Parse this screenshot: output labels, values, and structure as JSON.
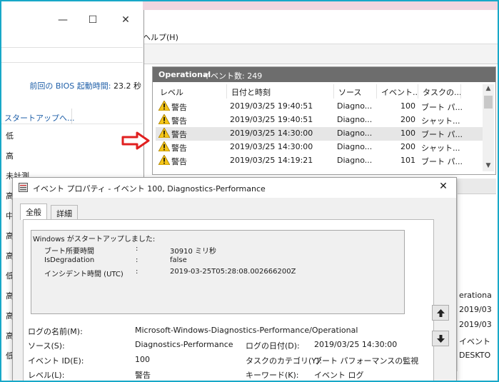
{
  "event_viewer": {
    "menu_help": "ヘルプ(H)",
    "operational": {
      "title": "Operational",
      "count_label": "イベント数: 249"
    },
    "columns": [
      "レベル",
      "日付と時刻",
      "ソース",
      "イベント...",
      "タスクの..."
    ],
    "rows": [
      {
        "level": "警告",
        "datetime": "2019/03/25 19:40:51",
        "source": "Diagno...",
        "id": "100",
        "task": "ブート パ..."
      },
      {
        "level": "警告",
        "datetime": "2019/03/25 19:40:51",
        "source": "Diagno...",
        "id": "200",
        "task": "シャット..."
      },
      {
        "level": "警告",
        "datetime": "2019/03/25 14:30:00",
        "source": "Diagno...",
        "id": "100",
        "task": "ブート パ..."
      },
      {
        "level": "警告",
        "datetime": "2019/03/25 14:30:00",
        "source": "Diagno...",
        "id": "200",
        "task": "シャット..."
      },
      {
        "level": "警告",
        "datetime": "2019/03/25 14:19:21",
        "source": "Diagno...",
        "id": "101",
        "task": "ブート パ..."
      }
    ],
    "right_fragments": [
      "erationa",
      "2019/03",
      "2019/03",
      "イベント",
      "DESKTO"
    ]
  },
  "perf_window": {
    "bios_label": "前回の BIOS 起動時間:",
    "bios_value": "23.2 秒",
    "column_header": "スタートアップへ...",
    "values": [
      "低",
      "高",
      "未計測",
      "高",
      "中",
      "高",
      "高",
      "低",
      "高",
      "高",
      "高",
      "低"
    ]
  },
  "dialog": {
    "title": "イベント プロパティ - イベント 100, Diagnostics-Performance",
    "tabs": [
      "全般",
      "詳細"
    ],
    "description": {
      "headline": "Windows がスタートアップしました:",
      "lines": [
        {
          "label": "ブート所要時間",
          "sep": ":",
          "value": "30910 ミリ秒"
        },
        {
          "label": "IsDegradation",
          "sep": ":",
          "value": "false"
        },
        {
          "label": "インシデント時間 (UTC)",
          "sep": ":",
          "value": "2019-03-25T05:28:08.002666200Z"
        }
      ]
    },
    "fields": {
      "log_name_label": "ログの名前(M):",
      "log_name_value": "Microsoft-Windows-Diagnostics-Performance/Operational",
      "source_label": "ソース(S):",
      "source_value": "Diagnostics-Performance",
      "log_date_label": "ログの日付(D):",
      "log_date_value": "2019/03/25 14:30:00",
      "event_id_label": "イベント ID(E):",
      "event_id_value": "100",
      "task_category_label": "タスクのカテゴリ(Y):",
      "task_category_value": "ブート パフォーマンスの監視",
      "level_label": "レベル(L):",
      "level_value": "警告",
      "keyword_label": "キーワード(K):",
      "keyword_value": "イベント ログ"
    }
  },
  "colors": {
    "frame": "#18a8c8",
    "arrow": "#e02020",
    "header": "#6d6d6d",
    "warning": "#f5c518"
  }
}
